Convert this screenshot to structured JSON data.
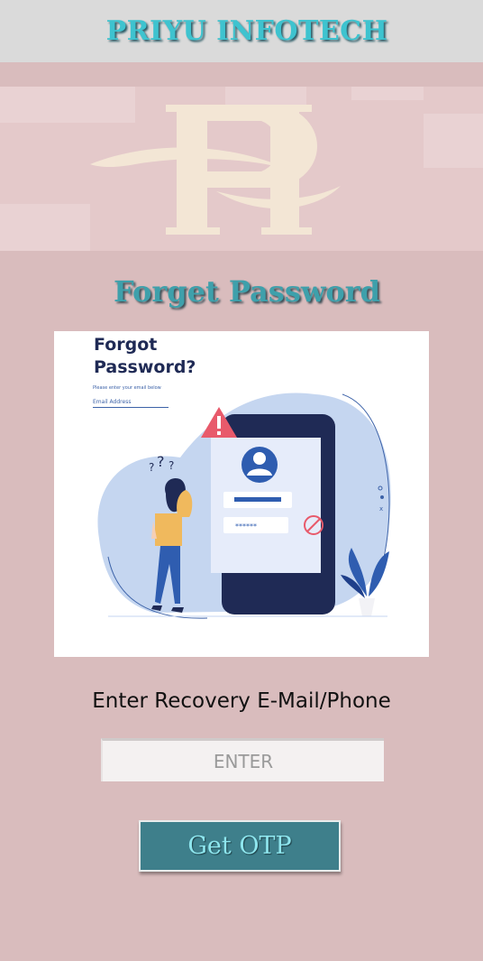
{
  "header": {
    "title": "PRIYU INFOTECH"
  },
  "banner": {
    "logo_text": "PI"
  },
  "page": {
    "title": "Forget Password"
  },
  "illustration": {
    "heading": "Forgot Password?",
    "hint": "Please enter your email below",
    "email_label": "Email Address",
    "password_mask": "******"
  },
  "form": {
    "recovery_label": "Enter Recovery E-Mail/Phone",
    "input_placeholder": "ENTER",
    "input_value": "",
    "submit_label": "Get OTP"
  },
  "colors": {
    "background": "#d9bcbd",
    "header_bg": "#dadada",
    "title_accent": "#3ec3cf",
    "button_bg": "#3e7f8b",
    "button_text": "#8ee6ee"
  }
}
